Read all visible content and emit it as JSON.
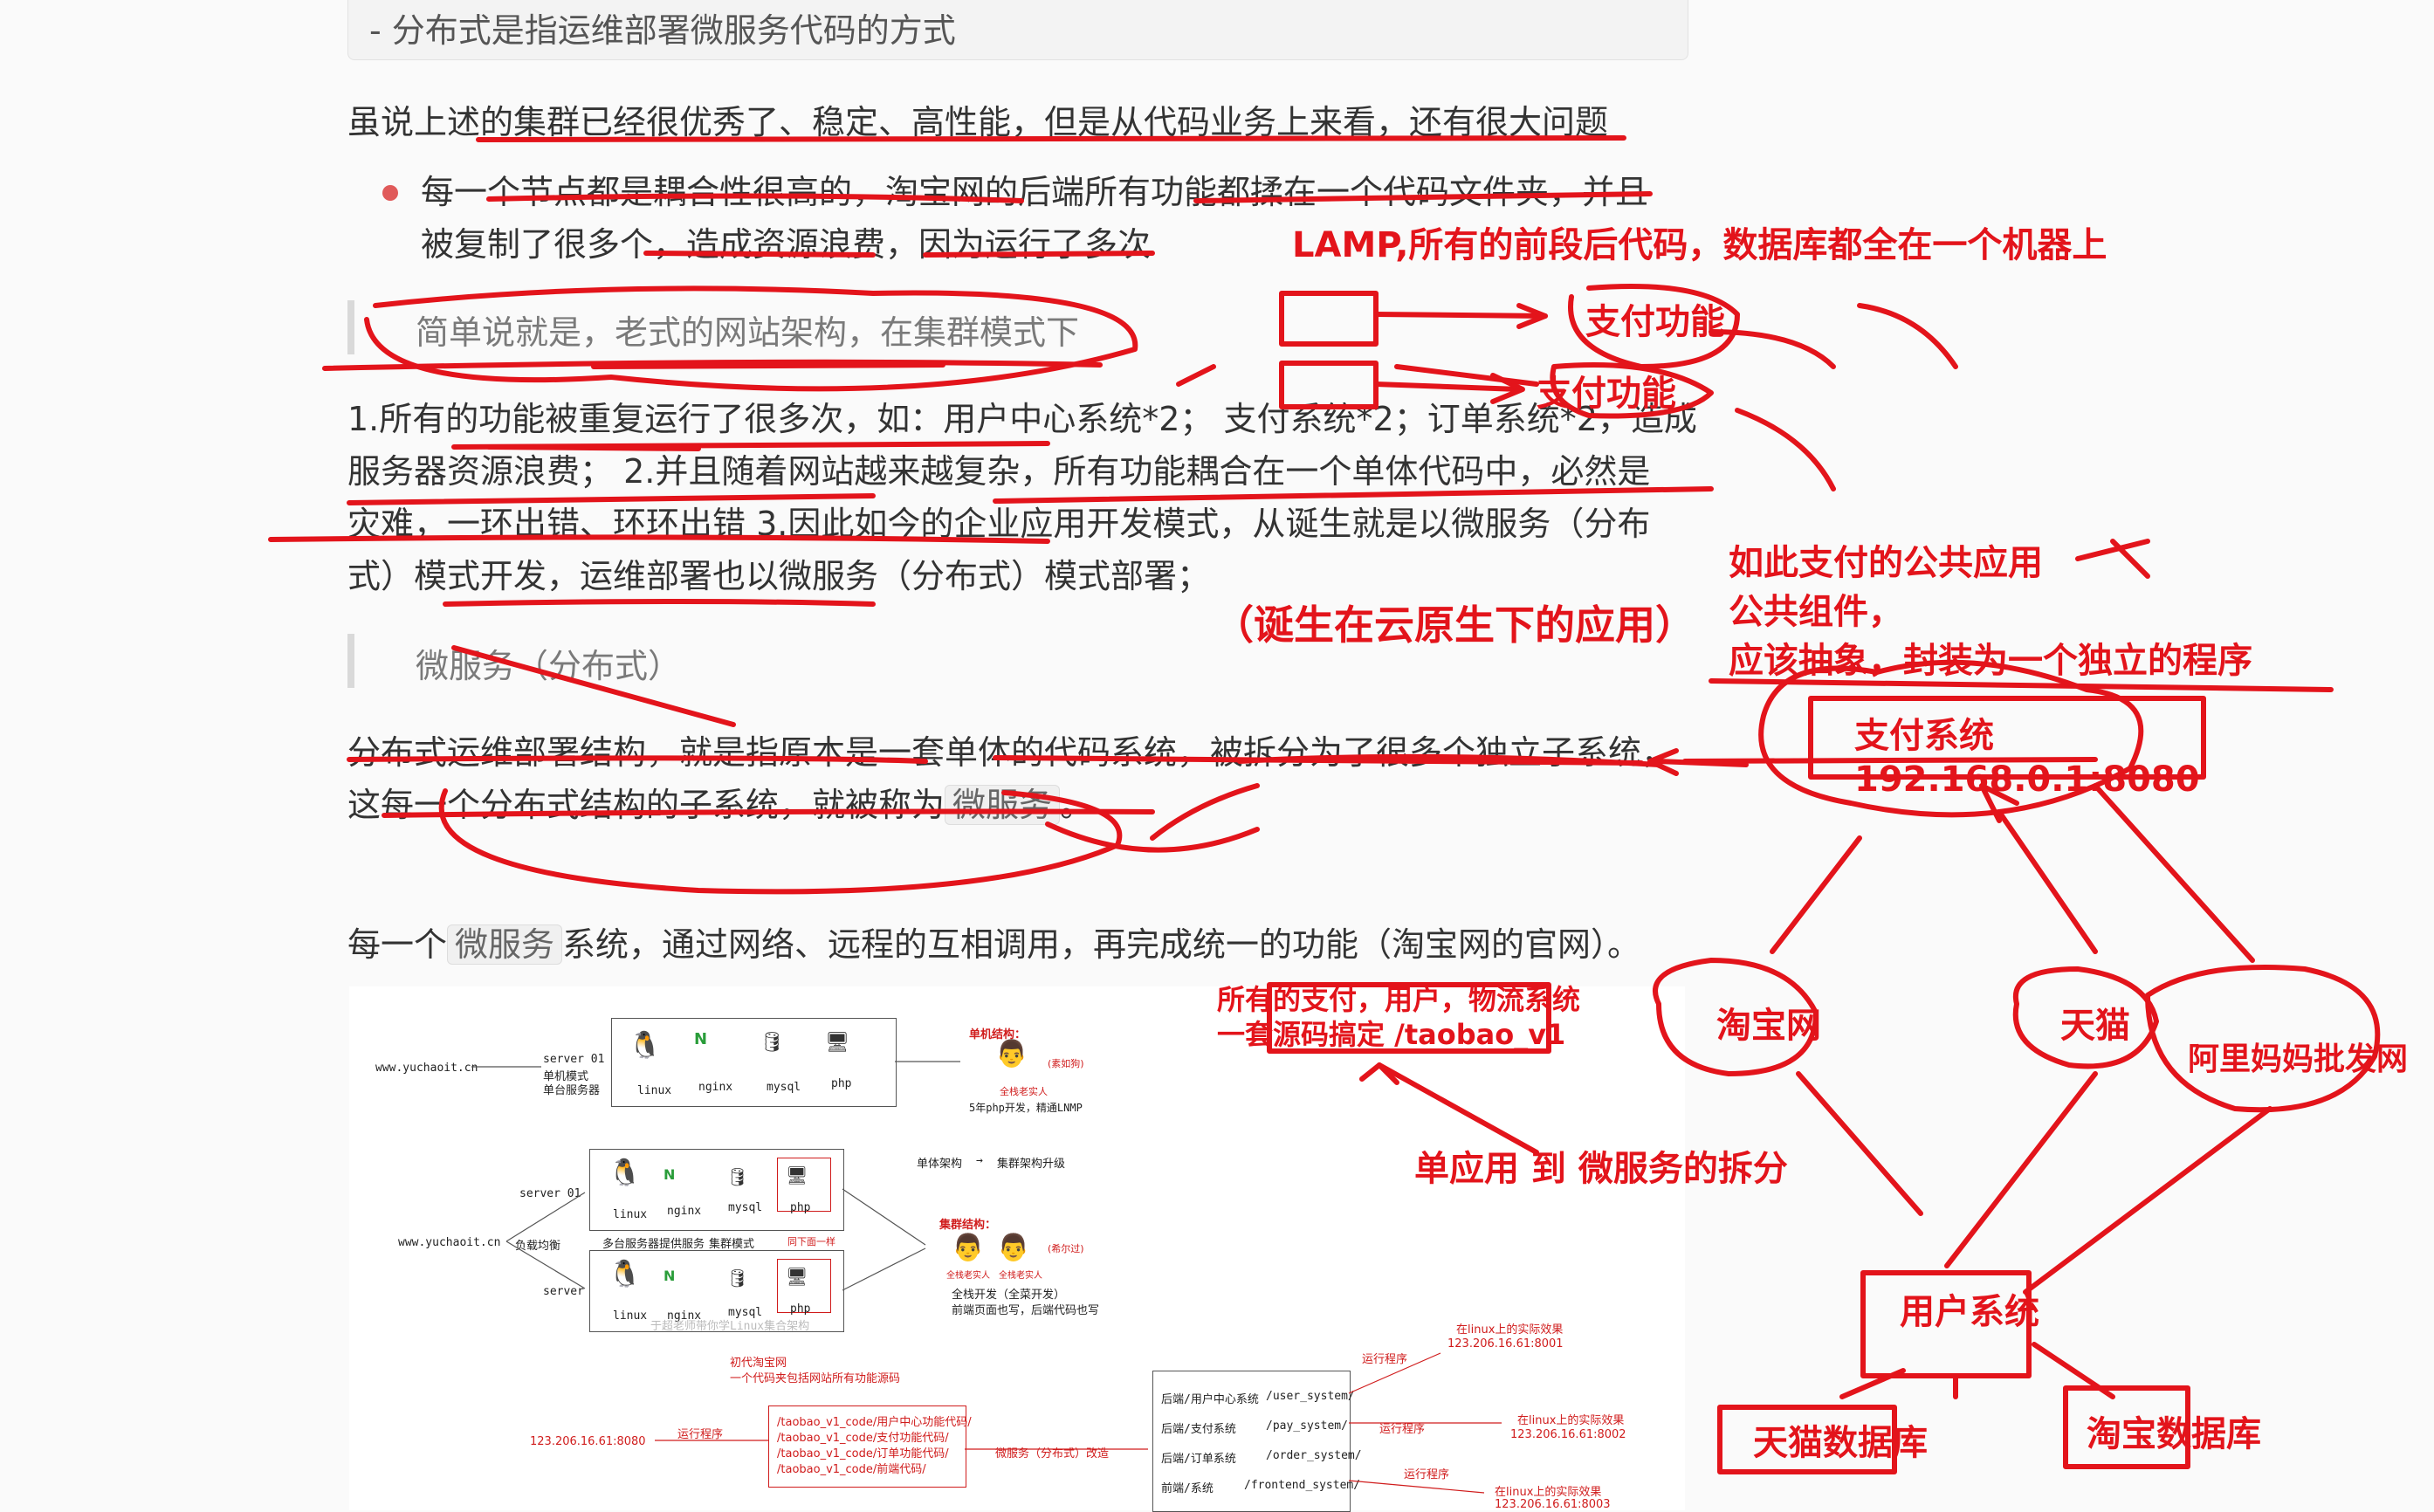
{
  "quote_top": "-  分布式是指运维部署微服务代码的方式",
  "intro": "虽说上述的集群已经很优秀了、稳定、高性能，但是从代码业务上来看，还有很大问题",
  "bullet_line1": "每一个节点都是耦合性很高的，淘宝网的后端所有功能都揉在一个代码文件夹，并且",
  "bullet_line2": "被复制了很多个，造成资源浪费，因为运行了多次",
  "blockquote1": "简单说就是，老式的网站架构，在集群模式下",
  "para_lines": [
    "1.所有的功能被重复运行了很多次，如：用户中心系统*2； 支付系统*2；订单系统*2，造成",
    "服务器资源浪费； 2.并且随着网站越来越复杂，所有功能耦合在一个单体代码中，必然是",
    "灾难，一环出错、环环出错 3.因此如今的企业应用开发模式，从诞生就是以微服务（分布",
    "式）模式开发，运维部署也以微服务（分布式）模式部署；"
  ],
  "blockquote2": "微服务（分布式）",
  "dist_line1": "分布式运维部署结构，就是指原本是一套单体的代码系统，被拆分为了很多个独立子系统，",
  "dist_line2_a": "这每一个分布式结构的子系统，就被称为",
  "dist_line2_code": "微服务",
  "dist_line2_b": "。",
  "each_a": "每一个",
  "each_code": "微服务",
  "each_b": "系统，通过网络、远程的互相调用，再完成统一的功能（淘宝网的官网）。",
  "annotations": {
    "lamp": "LAMP,所有的前段后代码，数据库都全在一个机器上",
    "pay1": "支付功能",
    "pay2": "支付功能",
    "public1": "如此支付的公共应用",
    "public2": "公共组件，",
    "public3": "应该抽象，封装为一个独立的程序",
    "cloud": "（诞生在云原生下的应用）",
    "pay_sys": "支付系统",
    "pay_ip": "192.168.0.1:8080",
    "all_in1": "所有的支付，用户，物流系统",
    "all_in2": "一套源码搞定 /taobao_v1",
    "taobao": "淘宝网",
    "tmall": "天猫",
    "alibaba": "阿里妈妈批发网",
    "split": "单应用 到  微服务的拆分",
    "user_sys": "用户系统",
    "tmall_db": "天猫数据库",
    "taobao_db": "淘宝数据库"
  },
  "diagram": {
    "site1": "www.yuchaoit.cn",
    "server01": "server 01",
    "single_mode": "单机模式",
    "single_server": "单台服务器",
    "linux": "linux",
    "nginx": "nginx",
    "mysql": "mysql",
    "php": "php",
    "single_struct": "单机结构：",
    "gucci": "(素如狗)",
    "fullstack": "全栈老实人",
    "fiveyear": "5年php开发，精通LNMP",
    "single_arch": "单体架构",
    "arrow_upgrade": "→",
    "cluster_upgrade": "集群架构升级",
    "site2": "www.yuchaoit.cn",
    "load_balance": "负载均衡",
    "server01b": "server 01",
    "server02": "server 02",
    "multi_server": "多台服务器提供服务",
    "cluster_mode": "集群模式",
    "same_below": "同下面一样",
    "cluster_struct": "集群结构：",
    "flag": "(希尔过)",
    "fs1": "全栈老实人",
    "fs2": "全栈老实人",
    "fs_dev": "全栈开发（全菜开发）",
    "fe_be": "前端页面也写，后端代码也写",
    "watermark": "于超老师带你学Linux集合架构",
    "early_taobao": "初代淘宝网",
    "one_code": "一个代码夹包括网站所有功能源码",
    "ip_left": "123.206.16.61:8080",
    "run_prog": "运行程序",
    "code_lines": [
      "/taobao_v1_code/用户中心功能代码/",
      "/taobao_v1_code/支付功能代码/",
      "/taobao_v1_code/订单功能代码/",
      "/taobao_v1_code/前端代码/"
    ],
    "micro_reform": "微服务（分布式）改造",
    "svc_rows": [
      {
        "name": "后端/用户中心系统",
        "path": "/user_system/"
      },
      {
        "name": "后端/支付系统",
        "path": "/pay_system/"
      },
      {
        "name": "后端/订单系统",
        "path": "/order_system/"
      },
      {
        "name": "前端/系统",
        "path": "/frontend_system/"
      }
    ],
    "run_prog2": "运行程序",
    "run_prog3": "运行程序",
    "run_prog4": "运行程序",
    "actual_1": "在linux上的实际效果",
    "ip_1": "123.206.16.61:8001",
    "actual_2": "在linux上的实际效果",
    "ip_2": "123.206.16.61:8002",
    "actual_3": "在linux上的实际效果",
    "ip_3": "123.206.16.61:8003"
  }
}
